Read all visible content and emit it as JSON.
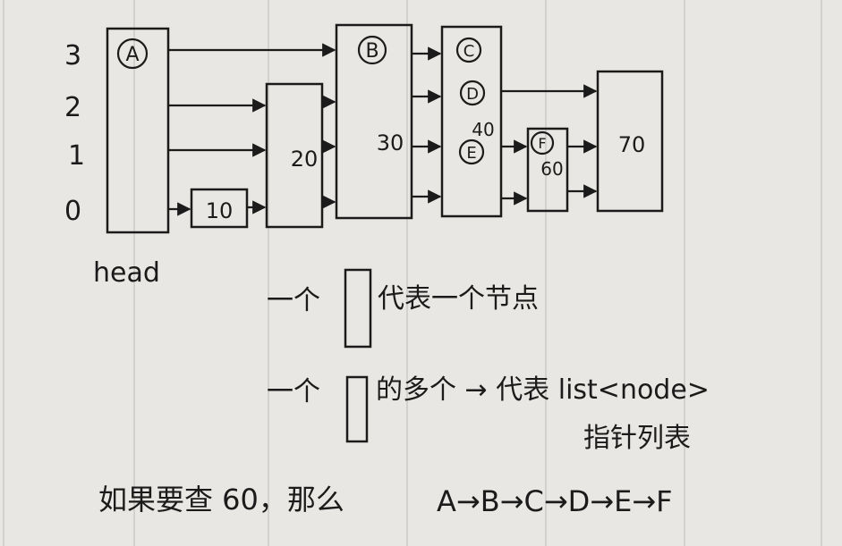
{
  "diagram": {
    "level_labels": [
      "3",
      "2",
      "1",
      "0"
    ],
    "head_label": "head",
    "nodes": [
      {
        "id": "A",
        "letter": "A",
        "value": ""
      },
      {
        "id": "B",
        "letter": "B",
        "value": "30"
      },
      {
        "id": "C",
        "letter": "C",
        "value": ""
      },
      {
        "id": "D",
        "letter": "D",
        "value": "40"
      },
      {
        "id": "E",
        "letter": "E",
        "value": ""
      },
      {
        "id": "F",
        "letter": "F",
        "value": "60"
      }
    ],
    "plain_nodes": [
      {
        "id": "n10",
        "value": "10"
      },
      {
        "id": "n20",
        "value": "20"
      },
      {
        "id": "n70",
        "value": "70"
      }
    ],
    "legend": [
      {
        "prefix": "一个",
        "text": "代表一个节点"
      },
      {
        "prefix": "一个",
        "text": "的多个 → 代表 list<node>",
        "text2": "指针列表"
      }
    ],
    "query": {
      "text": "如果要查 60，那么",
      "path": "A→B→C→D→E→F"
    }
  },
  "colors": {
    "ink": "#1b1b1b",
    "paper": "#e9e7e3",
    "rule": "#d3d1cd"
  }
}
